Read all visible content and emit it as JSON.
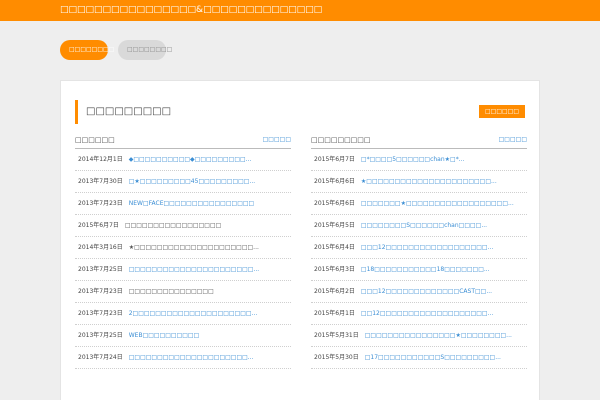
{
  "header": {
    "title": "□□□□□□□□□□□□□□□□&□□□□□□□□□□□□□□"
  },
  "tabs": [
    {
      "label": "□□□□□□□□"
    },
    {
      "label": "□□□□□□□□"
    }
  ],
  "panel": {
    "title": "□□□□□□□□□",
    "more_button": "□□□□□□",
    "left": {
      "title": "□□□□□□",
      "more": "□□□□□",
      "rows": [
        {
          "date": "2014年12月1日",
          "title": "◆□□□□□□□□□□◆□□□□□□□□□..."
        },
        {
          "date": "2013年7月30日",
          "title": "□★□□□□□□□□□45□□□□□□□□□..."
        },
        {
          "date": "2013年7月23日",
          "title": "NEW□FACE□□□□□□□□□□□□□□□□"
        },
        {
          "date": "2015年6月7日",
          "title": "□□□□□□□□□□□□□□□□□"
        },
        {
          "date": "2014年3月16日",
          "title": "★□□□□□□□□□□□□□□□□□□□□□..."
        },
        {
          "date": "2013年7月25日",
          "title": "□□□□□□□□□□□□□□□□□□□□□□..."
        },
        {
          "date": "2013年7月23日",
          "title": "□□□□□□□□□□□□□□□"
        },
        {
          "date": "2013年7月23日",
          "title": "2□□□□□□□□□□□□□□□□□□□□□..."
        },
        {
          "date": "2013年7月25日",
          "title": "WEB□□□□□□□□□□"
        },
        {
          "date": "2013年7月24日",
          "title": "□□□□□□□□□□□□□□□□□□□□□..."
        }
      ]
    },
    "right": {
      "title": "□□□□□□□□□",
      "more": "□□□□□",
      "rows": [
        {
          "date": "2015年6月7日",
          "title": "□*□□□□5□□□□□□chan★□*..."
        },
        {
          "date": "2015年6月6日",
          "title": "★□□□□□□□□□□□□□□□□□□□□□□..."
        },
        {
          "date": "2015年6月6日",
          "title": "□□□□□□□★□□□□□□□□□□□□□□□□□□..."
        },
        {
          "date": "2015年6月5日",
          "title": "□□□□□□□□S□□□□□□chan□□□□..."
        },
        {
          "date": "2015年6月4日",
          "title": "□□□12□□□□□□□□□□□□□□□□□□..."
        },
        {
          "date": "2015年6月3日",
          "title": "□18□□□□□□□□□□□18□□□□□□□..."
        },
        {
          "date": "2015年6月2日",
          "title": "□□□12□□□□□□□□□□□□□CAST□□..."
        },
        {
          "date": "2015年6月1日",
          "title": "□□12□□□□□□□□□□□□□□□□□□□..."
        },
        {
          "date": "2015年5月31日",
          "title": "□□□□□□□□□□□□□□□□★□□□□□□□□..."
        },
        {
          "date": "2015年5月30日",
          "title": "□17□□□□□□□□□□□S□□□□□□□□□..."
        }
      ]
    }
  }
}
